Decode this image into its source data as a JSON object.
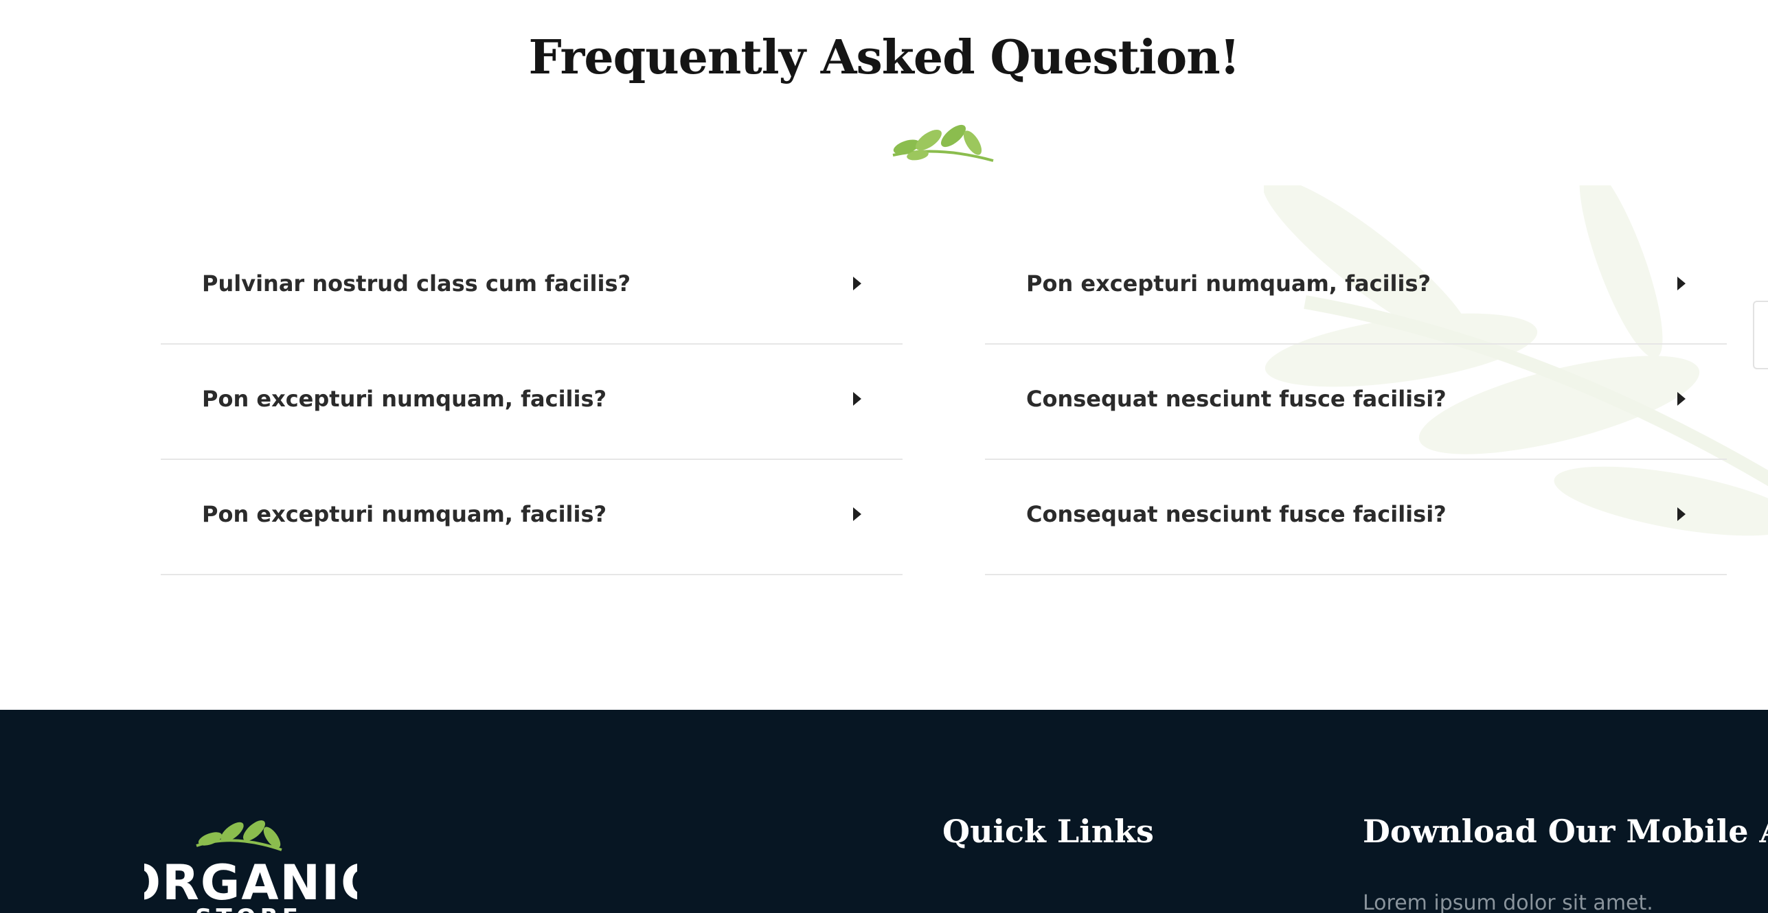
{
  "faq": {
    "title": "Frequently Asked Question!",
    "items_left": [
      {
        "question": "Pulvinar nostrud class cum facilis?"
      },
      {
        "question": "Pon excepturi numquam, facilis?"
      },
      {
        "question": "Pon excepturi numquam, facilis?"
      }
    ],
    "items_right": [
      {
        "question": "Pon excepturi numquam, facilis?"
      },
      {
        "question": "Consequat nesciunt fusce facilisi?"
      },
      {
        "question": "Consequat nesciunt fusce facilisi?"
      }
    ]
  },
  "footer": {
    "logo_text": "ORGANIC STORE",
    "quick_links_heading": "Quick Links",
    "download_heading": "Download Our Mobile App",
    "download_text": "Lorem ipsum dolor sit amet."
  },
  "colors": {
    "accent_green": "#8bbd4e",
    "footer_bg": "#071623",
    "heading_text": "#151515"
  },
  "icons": {
    "title_ornament": "leaf-sprig-icon",
    "faq_toggle": "caret-right-icon"
  }
}
